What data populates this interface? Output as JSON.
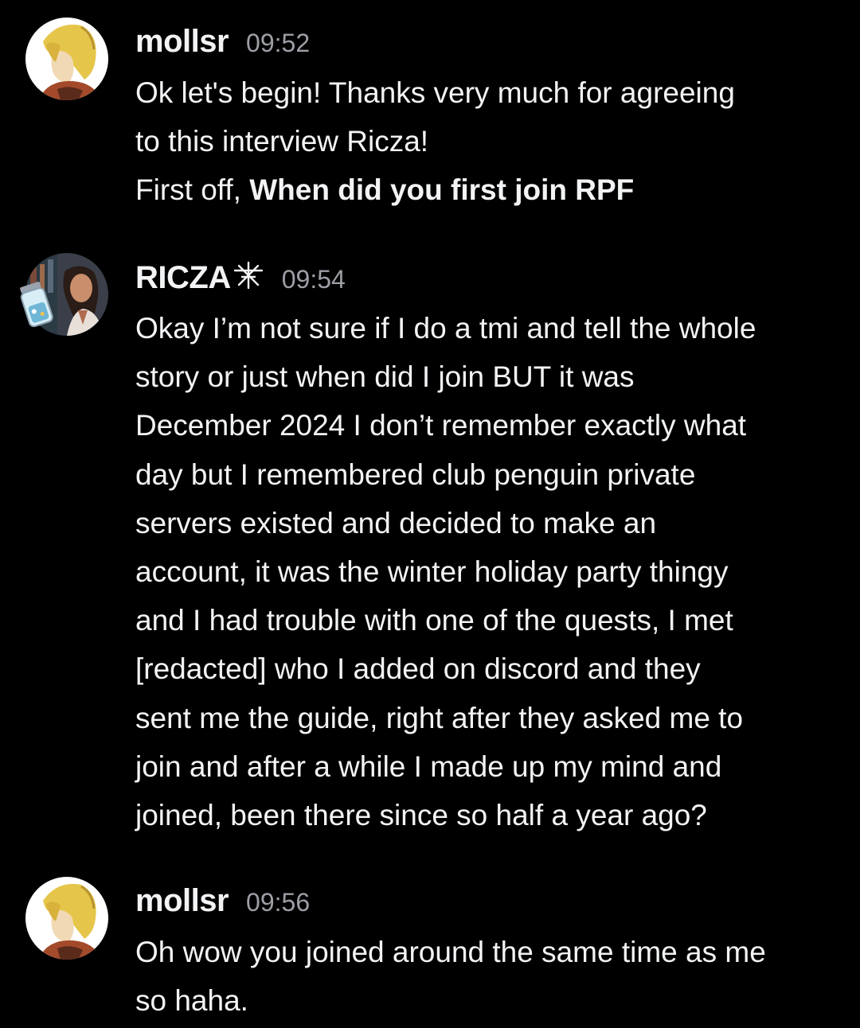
{
  "messages": [
    {
      "username": "mollsr",
      "timestamp": "09:52",
      "lines": [
        "Ok let's begin! Thanks very much for agreeing",
        "to this interview Ricza!"
      ],
      "line3_prefix": "First off, ",
      "line3_bold": "When did you first join RPF"
    },
    {
      "username": "RICZA",
      "badge": "✠",
      "timestamp": "09:54",
      "lines": [
        "Okay I’m not sure if I do a tmi and tell the whole",
        "story or just when did I join BUT it was",
        "December 2024 I don’t remember exactly what",
        "day but I remembered club penguin private",
        "servers existed and decided to make an",
        "account, it was the winter holiday party thingy",
        "and I had trouble with one of the quests, I met",
        "[redacted] who I added on discord and they",
        "sent me the guide, right after they asked me to",
        "join and after a while I made up my mind and",
        "joined, been there since so half a year ago?"
      ]
    },
    {
      "username": "mollsr",
      "timestamp": "09:56",
      "lines": [
        "Oh wow you joined around the same time as me",
        "so haha."
      ]
    }
  ],
  "colors": {
    "background": "#000000",
    "text": "#f2f3f5",
    "timestamp": "#9d9fa6"
  },
  "icons": {
    "avatar_mollsr": "anime-character-avatar",
    "avatar_ricza": "woman-portrait-avatar",
    "badge_ricza": "pentagram-star-icon",
    "decoration_ricza": "glass-jar-decoration"
  }
}
